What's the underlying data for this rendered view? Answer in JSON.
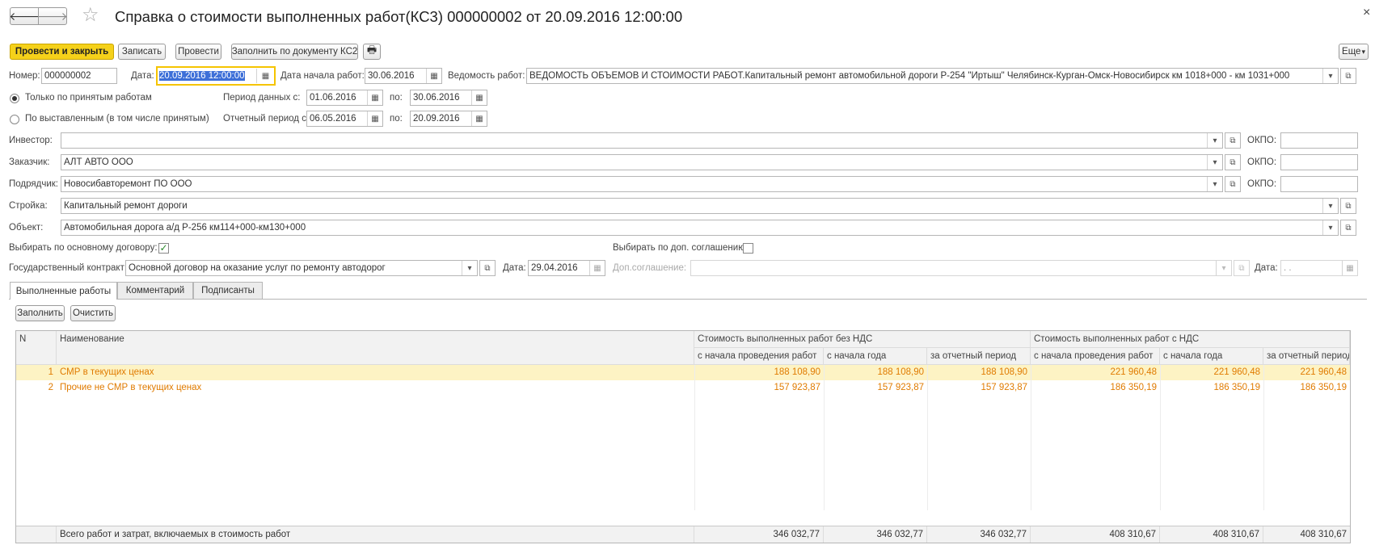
{
  "window": {
    "title": "Справка о стоимости выполненных работ(КС3) 000000002 от 20.09.2016 12:00:00",
    "close_glyph": "×",
    "back_glyph": "🡐",
    "forward_glyph": "🡒",
    "star_glyph": "☆"
  },
  "toolbar": {
    "post_close": "Провести и закрыть",
    "save": "Записать",
    "post": "Провести",
    "fill_by_doc": "Заполнить по документу КС2",
    "print_glyph": "🖶",
    "more": "Еще"
  },
  "header": {
    "number_label": "Номер:",
    "number_value": "000000002",
    "date_label": "Дата:",
    "date_value": "20.09.2016 12:00:00",
    "start_date_label": "Дата начала работ:",
    "start_date_value": "30.06.2016",
    "statement_label": "Ведомость работ:",
    "statement_value": "ВЕДОМОСТЬ ОБЪЕМОВ И СТОИМОСТИ РАБОТ.Капитальный ремонт автомобильной дороги Р-254 \"Иртыш\" Челябинск-Курган-Омск-Новосибирск  км 1018+000 - км 1031+000"
  },
  "options": {
    "accepted_only": "Только по принятым работам",
    "billed": "По выставленным (в том числе принятым)",
    "data_period_label": "Период данных с:",
    "data_period_from": "01.06.2016",
    "to_label": "по:",
    "data_period_to": "30.06.2016",
    "report_period_label": "Отчетный период с:",
    "report_period_from": "06.05.2016",
    "report_period_to": "20.09.2016"
  },
  "parties": {
    "investor_label": "Инвестор:",
    "investor_value": "",
    "customer_label": "Заказчик:",
    "customer_value": "АЛТ АВТО ООО",
    "contractor_label": "Подрядчик:",
    "contractor_value": "Новосибавторемонт ПО ООО",
    "okpo_label": "ОКПО:",
    "construction_label": "Стройка:",
    "construction_value": "Капитальный ремонт дороги",
    "object_label": "Объект:",
    "object_value": "Автомобильная дорога а/д Р-256 км114+000-км130+000"
  },
  "contract": {
    "by_main_label": "Выбирать по основному договору:",
    "by_supp_label": "Выбирать по доп. соглашению:",
    "gov_contract_label": "Государственный контракт:",
    "gov_contract_value": "Основной договор на оказание услуг по ремонту автодорог",
    "date_label": "Дата:",
    "date_value": "29.04.2016",
    "supp_label": "Доп.соглашение:",
    "supp_value": "",
    "supp_date_label": "Дата:",
    "supp_date_value": " .  ."
  },
  "tabs": [
    "Выполненные работы",
    "Комментарий",
    "Подписанты"
  ],
  "table_toolbar": {
    "fill": "Заполнить",
    "clear": "Очистить"
  },
  "table": {
    "col_n": "N",
    "col_name": "Наименование",
    "group_without_vat": "Стоимость выполненных работ без НДС",
    "group_with_vat": "Стоимость выполненных работ с НДС",
    "sub_from_start": "с начала проведения работ",
    "sub_from_year": "с начала года",
    "sub_period": "за отчетный период",
    "rows": [
      {
        "n": "1",
        "name": "СМР в текущих ценах",
        "a": "188 108,90",
        "b": "188 108,90",
        "c": "188 108,90",
        "d": "221 960,48",
        "e": "221 960,48",
        "f": "221 960,48"
      },
      {
        "n": "2",
        "name": "Прочие не СМР в текущих ценах",
        "a": "157 923,87",
        "b": "157 923,87",
        "c": "157 923,87",
        "d": "186 350,19",
        "e": "186 350,19",
        "f": "186 350,19"
      }
    ],
    "footer": {
      "label": "Всего работ и затрат, включаемых в стоимость работ",
      "a": "346 032,77",
      "b": "346 032,77",
      "c": "346 032,77",
      "d": "408 310,67",
      "e": "408 310,67",
      "f": "408 310,67"
    }
  },
  "icons": {
    "calendar": "▦",
    "dropdown": "▾",
    "open": "⧉"
  },
  "colors": {
    "accent_yellow": "#f5d11a",
    "row_text": "#e07b00",
    "selected_row": "#fdf3c4",
    "date_focus": "#f5c400",
    "selection": "#3d6fd8"
  }
}
